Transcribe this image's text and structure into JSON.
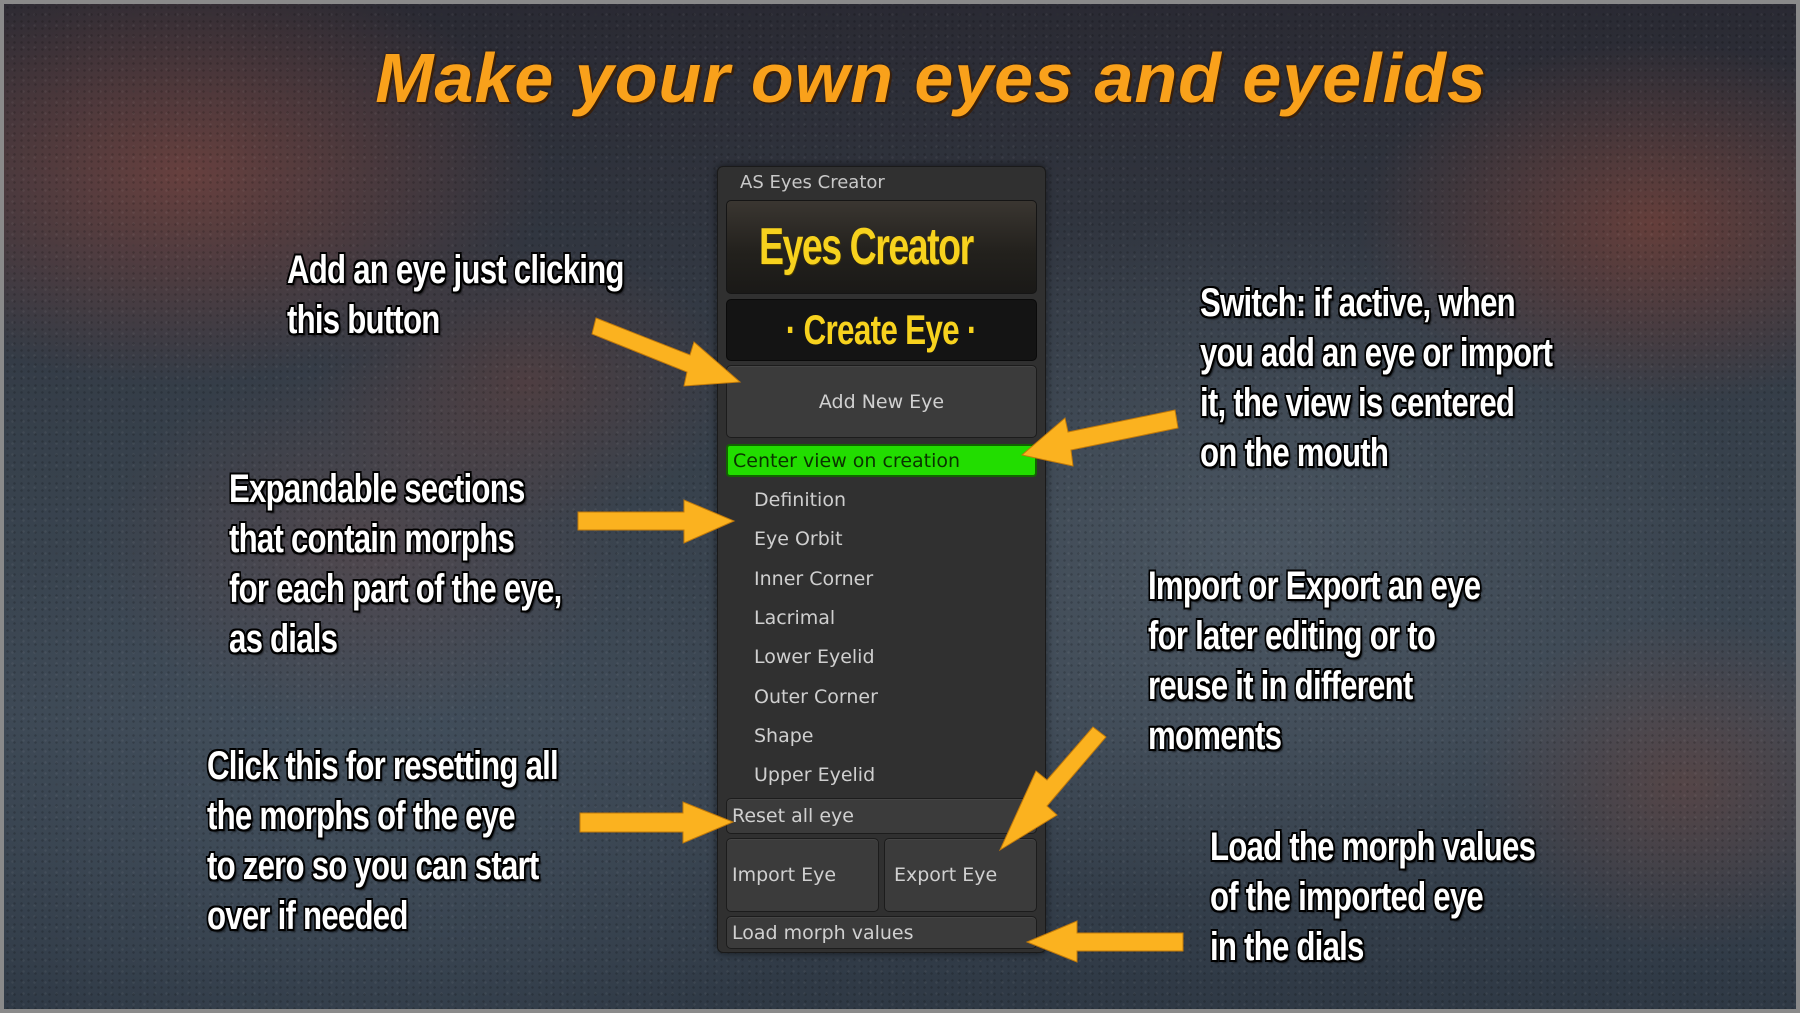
{
  "title": "Make your own eyes and eyelids",
  "panel": {
    "window_title": "AS Eyes Creator",
    "logo_text": "Eyes Creator",
    "logo_icon": "eye-sculpt-icon",
    "create_eye_label": "· Create Eye ·",
    "add_new_eye_label": "Add New Eye",
    "center_view_toggle": {
      "label": "Center view on creation",
      "active": true,
      "color": "#22dd00"
    },
    "sections": [
      "Definition",
      "Eye Orbit",
      "Inner Corner",
      "Lacrimal",
      "Lower Eyelid",
      "Outer Corner",
      "Shape",
      "Upper Eyelid"
    ],
    "reset_label": "Reset all eye",
    "import_label": "Import Eye",
    "export_label": "Export Eye",
    "load_morph_label": "Load morph values"
  },
  "callouts": {
    "add_eye": [
      "Add an eye just clicking",
      "this button"
    ],
    "switch": [
      "Switch: if active, when",
      "you add an eye or import",
      "it, the view is centered",
      "on the mouth"
    ],
    "sections": [
      "Expandable sections",
      "that contain morphs",
      "for each part of the eye,",
      "as dials"
    ],
    "import_export": [
      "Import or Export an eye",
      "for later editing or to",
      "reuse it in different",
      "moments"
    ],
    "reset": [
      "Click this for resetting all",
      "the morphs of the eye",
      "to zero so you can start",
      "over if needed"
    ],
    "load": [
      "Load the morph values",
      "of the imported eye",
      "in the dials"
    ]
  },
  "colors": {
    "title": "#f9a11b",
    "arrow": "#fbb21f",
    "logo_text": "#f7d21e"
  }
}
